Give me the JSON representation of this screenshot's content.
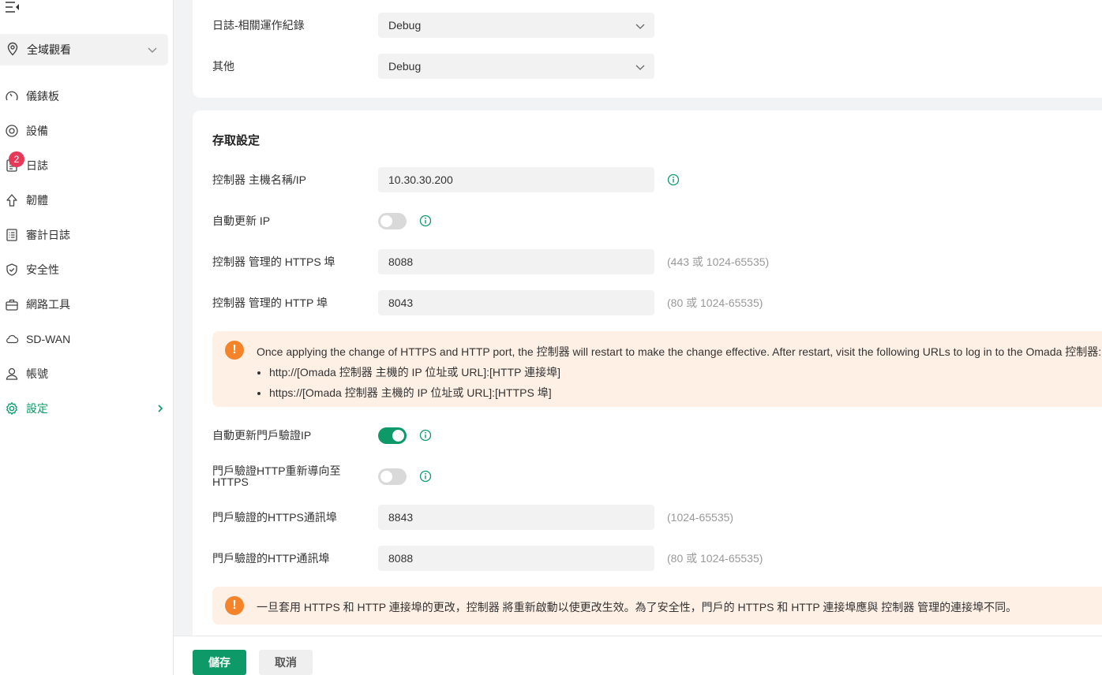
{
  "sidebar": {
    "site": "全域觀看",
    "badge_count": "2",
    "items": [
      {
        "label": "儀錶板",
        "icon": "gauge-icon"
      },
      {
        "label": "設備",
        "icon": "device-icon"
      },
      {
        "label": "日誌",
        "icon": "log-icon"
      },
      {
        "label": "韌體",
        "icon": "upgrade-icon"
      },
      {
        "label": "審計日誌",
        "icon": "audit-log-icon"
      },
      {
        "label": "安全性",
        "icon": "shield-icon"
      },
      {
        "label": "網路工具",
        "icon": "toolbox-icon"
      },
      {
        "label": "SD-WAN",
        "icon": "cloud-icon"
      },
      {
        "label": "帳號",
        "icon": "user-icon"
      },
      {
        "label": "設定",
        "icon": "gear-icon"
      }
    ]
  },
  "logs": {
    "related_label": "日誌-相關運作紀錄",
    "related_value": "Debug",
    "other_label": "其他",
    "other_value": "Debug"
  },
  "access": {
    "title": "存取設定",
    "host_label": "控制器 主機名稱/IP",
    "host_value": "10.30.30.200",
    "auto_ip_label": "自動更新 IP",
    "auto_ip_on": false,
    "https_port_label": "控制器 管理的 HTTPS 埠",
    "https_port_value": "8088",
    "https_port_hint": "(443 或 1024-65535)",
    "http_port_label": "控制器 管理的 HTTP 埠",
    "http_port_value": "8043",
    "http_port_hint": "(80 或 1024-65535)",
    "notice1": {
      "text": "Once applying the change of HTTPS and HTTP port, the 控制器 will restart to make the change effective. After restart, visit the following URLs to log in to the Omada 控制器:",
      "url1": "http://[Omada 控制器 主機的 IP 位址或 URL]:[HTTP 連接埠]",
      "url2": "https://[Omada 控制器 主機的 IP 位址或 URL]:[HTTPS 埠]"
    },
    "portal_auto_ip_label": "自動更新門戶驗證IP",
    "portal_auto_ip_on": true,
    "portal_redirect_label": "門戶驗證HTTP重新導向至HTTPS",
    "portal_redirect_on": false,
    "portal_https_label": "門戶驗證的HTTPS通訊埠",
    "portal_https_value": "8843",
    "portal_https_hint": "(1024-65535)",
    "portal_http_label": "門戶驗證的HTTP通訊埠",
    "portal_http_value": "8088",
    "portal_http_hint": "(80 或 1024-65535)",
    "notice2": "一旦套用 HTTPS 和 HTTP 連接埠的更改，控制器 將重新啟動以使更改生效。為了安全性，門戶的 HTTPS 和 HTTP 連接埠應與 控制器 管理的連接埠不同。"
  },
  "footer": {
    "save": "儲存",
    "cancel": "取消"
  },
  "colors": {
    "accent": "#0d9a68",
    "badge": "#e5395a",
    "warning": "#f5832a",
    "notice_bg": "#fff0e6"
  }
}
